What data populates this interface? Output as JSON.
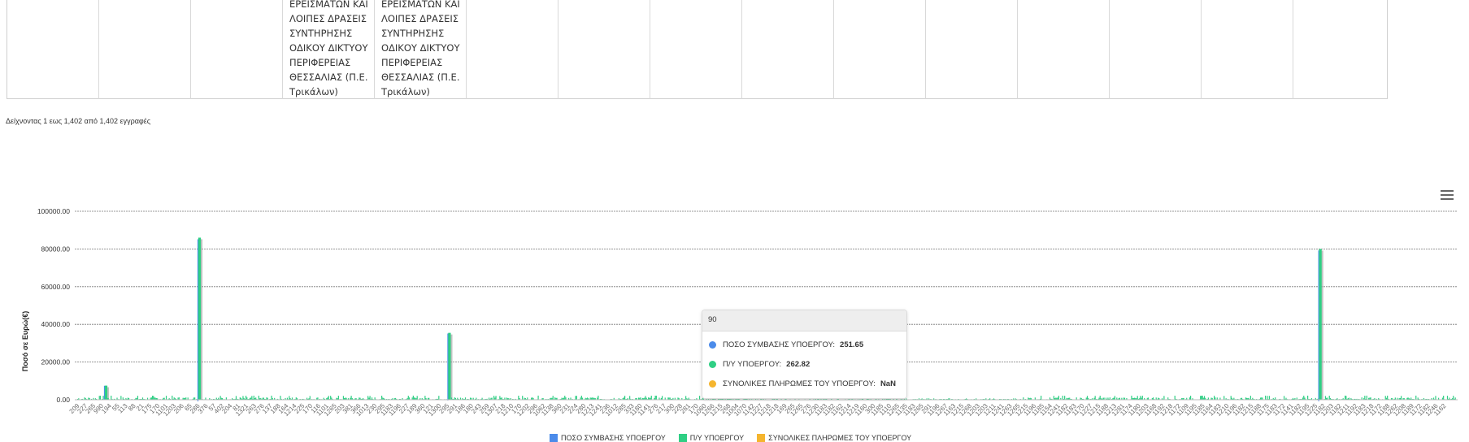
{
  "table": {
    "cells": [
      "ΕΡΕΙΣΜΑΤΩΝ ΚΑΙ\nΛΟΙΠΕΣ ΔΡΑΣΕΙΣ\nΣΥΝΤΗΡΗΣΗΣ\nΟΔΙΚΟΥ ΔΙΚΤΥΟΥ\nΠΕΡΙΦΕΡΕΙΑΣ\nΘΕΣΣΑΛΙΑΣ (Π.Ε.\nΤρικάλων)",
      "ΕΡΕΙΣΜΑΤΩΝ ΚΑΙ\nΛΟΙΠΕΣ ΔΡΑΣΕΙΣ\nΣΥΝΤΗΡΗΣΗΣ\nΟΔΙΚΟΥ ΔΙΚΤΥΟΥ\nΠΕΡΙΦΕΡΕΙΑΣ\nΘΕΣΣΑΛΙΑΣ (Π.Ε.\nΤρικάλων)"
    ]
  },
  "info": "Δείχνοντας 1 εως 1,402 από 1,402 εγγραφές",
  "tooltip": {
    "header": "90",
    "rows": [
      {
        "label": "ΠΟΣΟ ΣΥΜΒΑΣΗΣ ΥΠΟΕΡΓΟΥ:",
        "value": "251.65",
        "color": "#4b8bea"
      },
      {
        "label": "Π/Υ ΥΠΟΕΡΓΟΥ:",
        "value": "262.82",
        "color": "#2fcf84"
      },
      {
        "label": "ΣΥΝΟΛΙΚΕΣ ΠΛΗΡΩΜΕΣ ΤΟΥ ΥΠΟΕΡΓΟΥ:",
        "value": "NaN",
        "color": "#f5b52e"
      }
    ]
  },
  "icons": {
    "menu": "hamburger-menu-icon"
  },
  "chart_data": {
    "type": "bar",
    "ylabel": "Ποσό σε Ευρώ(€)",
    "ylim": [
      0,
      100000
    ],
    "yticks": [
      "100000.00",
      "80000.00",
      "60000.00",
      "40000.00",
      "20000.00",
      "0.00"
    ],
    "grid": true,
    "legend_position": "bottom",
    "series": [
      {
        "name": "ΠΟΣΟ ΣΥΜΒΑΣΗΣ ΥΠΟΕΡΓΟΥ",
        "color": "#4b8bea"
      },
      {
        "name": "Π/Υ ΥΠΟΕΡΓΟΥ",
        "color": "#2fcf84"
      },
      {
        "name": "ΣΥΝΟΛΙΚΕΣ ΠΛΗΡΩΜΕΣ ΤΟΥ ΥΠΟΕΡΓΟΥ",
        "color": "#f5b52e"
      }
    ],
    "tick_labels": [
      "209",
      "227",
      "265",
      "990",
      "194",
      "55",
      "113",
      "88",
      "21",
      "175",
      "170",
      "1101",
      "1203",
      "206",
      "65",
      "286",
      "376",
      "57",
      "402",
      "204",
      "81",
      "1321",
      "263",
      "276",
      "137",
      "188",
      "164",
      "1214",
      "225",
      "170",
      "116",
      "1101",
      "1265",
      "203",
      "381",
      "366",
      "1013",
      "230",
      "295",
      "1183",
      "1196",
      "227",
      "189",
      "360",
      "121",
      "1300",
      "295",
      "291",
      "186",
      "180",
      "243",
      "259",
      "1307",
      "218",
      "1210",
      "170",
      "1202",
      "296",
      "1062",
      "1138",
      "360",
      "231",
      "224",
      "280",
      "1213",
      "1241",
      "236",
      "1012",
      "285",
      "333",
      "1180",
      "1141",
      "276",
      "217",
      "300",
      "228",
      "281",
      "170",
      "1060",
      "1266",
      "1215",
      "268",
      "1004",
      "1070",
      "1142",
      "1227",
      "1218",
      "1218",
      "169",
      "265",
      "1265",
      "276",
      "1230",
      "1183",
      "1182",
      "1162",
      "1214",
      "1219",
      "1160",
      "300",
      "1185",
      "1110",
      "1265",
      "1135",
      "1183",
      "1265",
      "291",
      "1196",
      "1267",
      "1163",
      "1215",
      "1268",
      "1203",
      "1203",
      "1211",
      "1241",
      "1263",
      "1265",
      "1215",
      "1196",
      "1185",
      "1154",
      "1241",
      "1182",
      "1183",
      "1170",
      "1227",
      "1215",
      "1188",
      "1213",
      "1281",
      "1174",
      "1180",
      "1203",
      "1168",
      "1192",
      "1218",
      "1172",
      "1109",
      "1195",
      "1185",
      "1164",
      "1183",
      "1210",
      "1196",
      "1182",
      "1215",
      "1188",
      "1175",
      "1183",
      "1172",
      "1141",
      "1182",
      "1195",
      "1225",
      "1182",
      "1203",
      "1182",
      "1211",
      "1192",
      "1183",
      "1218",
      "1172",
      "1188",
      "1262",
      "1208",
      "1189",
      "1172",
      "1182",
      "1246",
      "1162"
    ],
    "peaks": [
      {
        "index": 28,
        "value": 7500
      },
      {
        "index": 123,
        "value": 86000
      },
      {
        "index": 377,
        "value": 35500
      },
      {
        "index": 1262,
        "value": 80000
      }
    ],
    "bar_count": 1402
  }
}
